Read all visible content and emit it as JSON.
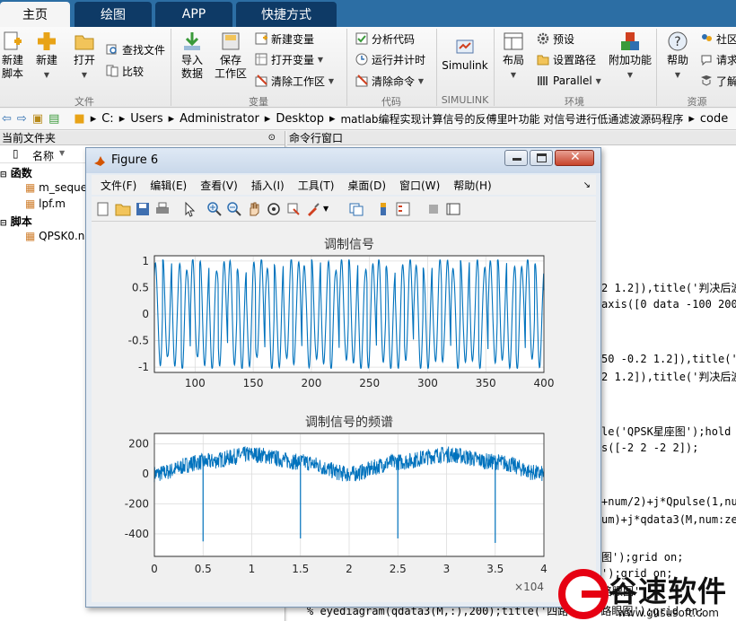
{
  "tabs": [
    {
      "label": "主页",
      "active": true
    },
    {
      "label": "绘图",
      "active": false
    },
    {
      "label": "APP",
      "active": false
    },
    {
      "label": "快捷方式",
      "active": false
    }
  ],
  "ribbon": {
    "file": {
      "new_script": "新建\n脚本",
      "new": "新建",
      "open": "打开",
      "find_files": "查找文件",
      "compare": "比较",
      "group": "文件"
    },
    "variable": {
      "import": "导入\n数据",
      "save_workspace": "保存\n工作区",
      "new_variable": "新建变量",
      "open_variable": "打开变量",
      "clear_workspace": "清除工作区",
      "group": "变量"
    },
    "code": {
      "analyze": "分析代码",
      "run_timing": "运行并计时",
      "clear_commands": "清除命令",
      "group": "代码"
    },
    "simulink": {
      "label": "Simulink",
      "group": "SIMULINK"
    },
    "env": {
      "layout": "布局",
      "preferences": "预设",
      "set_path": "设置路径",
      "parallel": "Parallel",
      "addons": "附加功能",
      "group": "环境"
    },
    "resources": {
      "help": "帮助",
      "community": "社区",
      "request": "请求",
      "learn": "了解",
      "group": "资源"
    }
  },
  "address": {
    "segments": [
      "C:",
      "Users",
      "Administrator",
      "Desktop",
      "matlab编程实现计算信号的反傅里叶功能 对信号进行低通滤波源码程序",
      "code"
    ]
  },
  "current_folder": {
    "title": "当前文件夹",
    "column": "名称",
    "sections": [
      {
        "heading": "函数",
        "items": [
          "m_seque",
          "lpf.m"
        ]
      },
      {
        "heading": "脚本",
        "items": [
          "QPSK0.n"
        ]
      }
    ]
  },
  "command_window": {
    "title": "命令行窗口",
    "lines": [
      "2 1.2]),title('判决后波",
      "axis([0 data -100 200",
      "50 -0.2 1.2]),title('基",
      "2 1.2]),title('判决后波",
      "le('QPSK星座图');hold",
      "s([-2 2 -2 2]);",
      "+num/2)+j*Qpulse(1,nu",
      "um)+j*qdata3(M,num:ze",
      "图');grid on;",
      "');grid on;",
      "路眼图'",
      "% eyediagram(qdata3(M,:),200);title('四路 ... 路眼图');grid on;"
    ]
  },
  "figure": {
    "title": "Figure 6",
    "menu": [
      "文件(F)",
      "编辑(E)",
      "查看(V)",
      "插入(I)",
      "工具(T)",
      "桌面(D)",
      "窗口(W)",
      "帮助(H)"
    ]
  },
  "chart_data": [
    {
      "type": "line",
      "title": "调制信号",
      "xlabel": "",
      "ylabel": "",
      "xlim": [
        65,
        400
      ],
      "ylim": [
        -1.1,
        1.1
      ],
      "xticks": [
        100,
        150,
        200,
        250,
        300,
        350,
        400
      ],
      "yticks": [
        -1,
        -0.5,
        0,
        0.5,
        1
      ],
      "grid": true,
      "color": "#0072bd",
      "series": [
        {
          "x_range": [
            65,
            400
          ],
          "amplitude": 1,
          "cycles_per_unit": 0.125
        }
      ]
    },
    {
      "type": "line",
      "title": "调制信号的频谱",
      "xlabel": "",
      "ylabel": "",
      "xlim": [
        0,
        40000
      ],
      "ylim": [
        -550,
        270
      ],
      "xticks": [
        0,
        0.5,
        1,
        1.5,
        2,
        2.5,
        3,
        3.5,
        4
      ],
      "x_multiplier": "×10^4",
      "yticks": [
        -400,
        -200,
        0,
        200
      ],
      "grid": true,
      "color": "#0072bd",
      "series": [
        {
          "envelope_x": [
            0,
            5000,
            10000,
            15000,
            20000,
            25000,
            30000,
            35000,
            40000
          ],
          "envelope_y": [
            0,
            80,
            130,
            80,
            0,
            80,
            130,
            80,
            0
          ],
          "dips_x": [
            5000,
            15000,
            25000,
            35000
          ],
          "dips_y": [
            -450,
            -430,
            -430,
            -460
          ]
        }
      ]
    }
  ],
  "watermark": {
    "brand": "谷速软件",
    "url": "www.gususoft.com",
    "logo_letter": "G"
  }
}
